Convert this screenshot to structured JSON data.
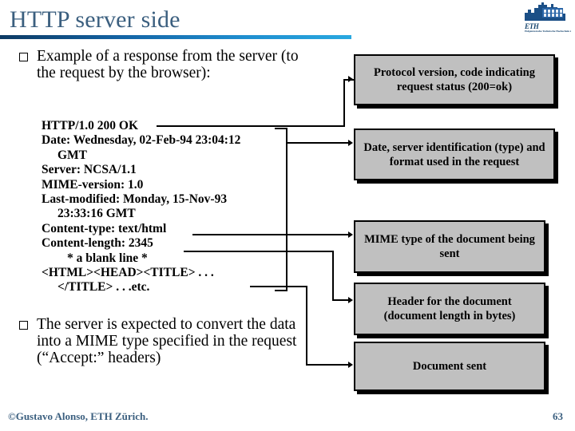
{
  "slide": {
    "title": "HTTP server side",
    "page_number": "63",
    "footer_credit": "©Gustavo Alonso, ETH Zürich.",
    "accent_color": "#3b5f7f",
    "rule_gradient_start": "#0d3a63",
    "rule_gradient_end": "#29a8e0",
    "callout_fill": "#c0c0c0"
  },
  "logo": {
    "name": "eth-logo",
    "wordmark": "ETH",
    "subtitle": "Eidgenössische Technische Hochschule Zürich"
  },
  "bullets": [
    {
      "marker": "hollow-square",
      "text": "Example of a response from the server (to the request by the browser):"
    },
    {
      "marker": "hollow-square",
      "text": "The server is expected to convert the data into a MIME type specified in the request (“Accept:” headers)"
    }
  ],
  "response_listing": {
    "lines": [
      {
        "text": "HTTP/1.0 200 OK",
        "indent": 0
      },
      {
        "text": "Date: Wednesday, 02-Feb-94 23:04:12",
        "indent": 0
      },
      {
        "text": "GMT",
        "indent": 1
      },
      {
        "text": "Server: NCSA/1.1",
        "indent": 0
      },
      {
        "text": "MIME-version: 1.0",
        "indent": 0
      },
      {
        "text": "Last-modified: Monday, 15-Nov-93",
        "indent": 0
      },
      {
        "text": "23:33:16 GMT",
        "indent": 1
      },
      {
        "text": "Content-type: text/html",
        "indent": 0
      },
      {
        "text": "Content-length: 2345",
        "indent": 0
      },
      {
        "text": "* a blank line *",
        "indent": 2
      },
      {
        "text": "<HTML><HEAD><TITLE> . . .",
        "indent": 0
      },
      {
        "text": "</TITLE> . . .etc.",
        "indent": 1
      }
    ]
  },
  "callouts": [
    {
      "id": "callout-1",
      "text": "Protocol version, code indicating request status (200=ok)"
    },
    {
      "id": "callout-2",
      "text": "Date, server identification (type) and format used in the request"
    },
    {
      "id": "callout-3",
      "text": "MIME type of the document being sent"
    },
    {
      "id": "callout-4",
      "text": "Header for the document (document length in bytes)"
    },
    {
      "id": "callout-5",
      "text": "Document sent"
    }
  ]
}
